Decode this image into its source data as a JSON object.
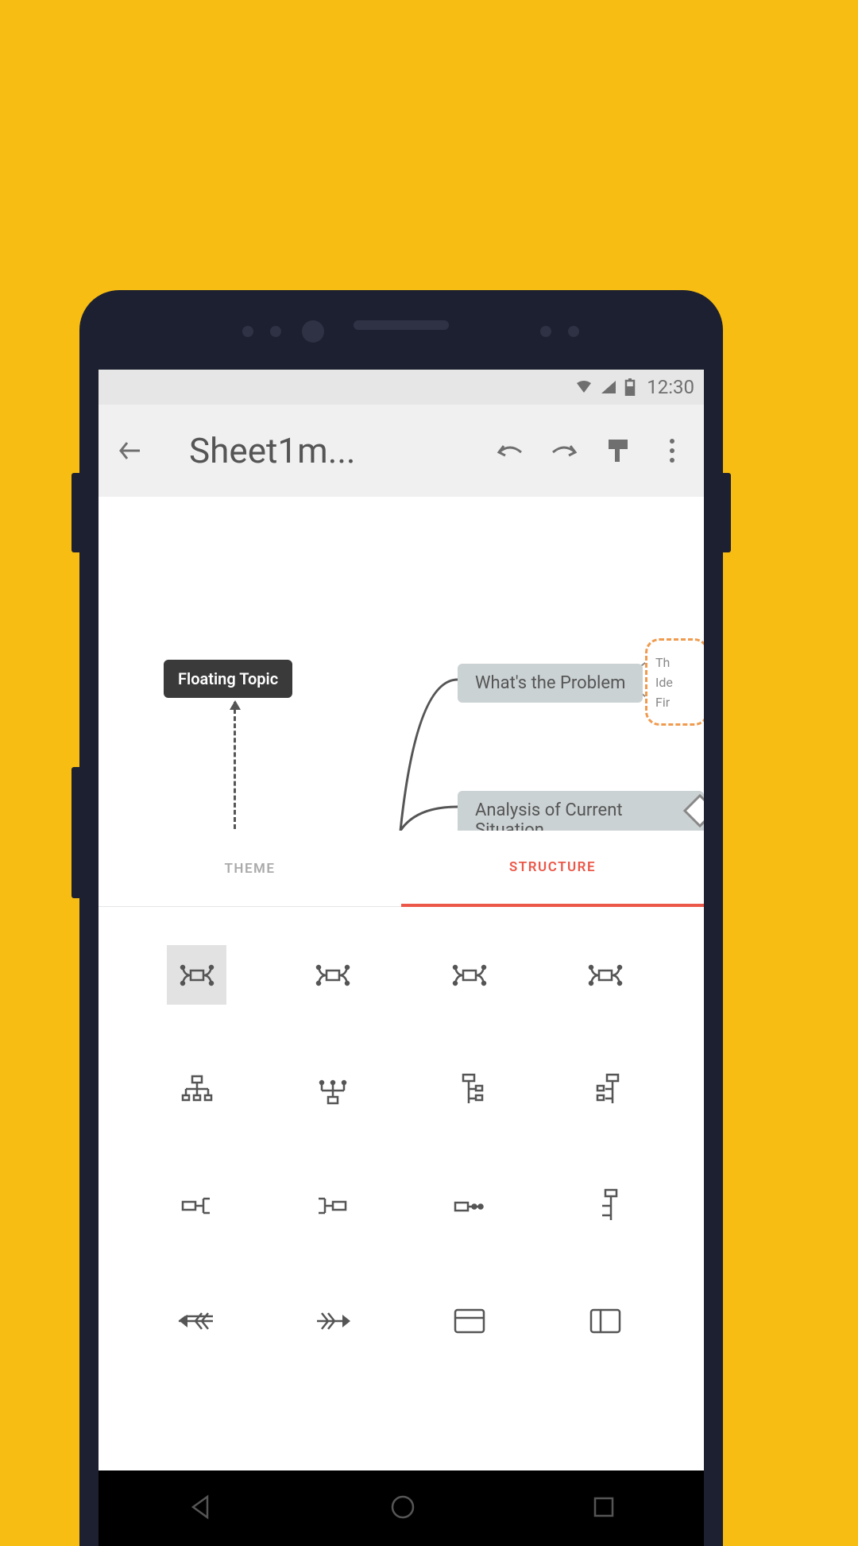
{
  "status": {
    "time": "12:30"
  },
  "appbar": {
    "title": "Sheet1m..."
  },
  "canvas": {
    "floating_label": "Floating Topic",
    "node1": "What's the Problem",
    "node2": "Analysis of Current Situation",
    "sub1": "Th",
    "sub2": "Ide",
    "sub3": "Fir"
  },
  "tabs": {
    "theme": "THEME",
    "structure": "STRUCTURE"
  },
  "structures": [
    {
      "name": "map-balanced",
      "selected": true
    },
    {
      "name": "map-clockwise"
    },
    {
      "name": "map-anticlockwise"
    },
    {
      "name": "map-radial"
    },
    {
      "name": "org-chart-down"
    },
    {
      "name": "org-chart-up"
    },
    {
      "name": "logic-right-1"
    },
    {
      "name": "logic-right-2"
    },
    {
      "name": "logic-left"
    },
    {
      "name": "tree-left"
    },
    {
      "name": "tree-right"
    },
    {
      "name": "logic-tree"
    },
    {
      "name": "fishbone-left"
    },
    {
      "name": "fishbone-right"
    },
    {
      "name": "spreadsheet"
    },
    {
      "name": "matrix"
    }
  ]
}
